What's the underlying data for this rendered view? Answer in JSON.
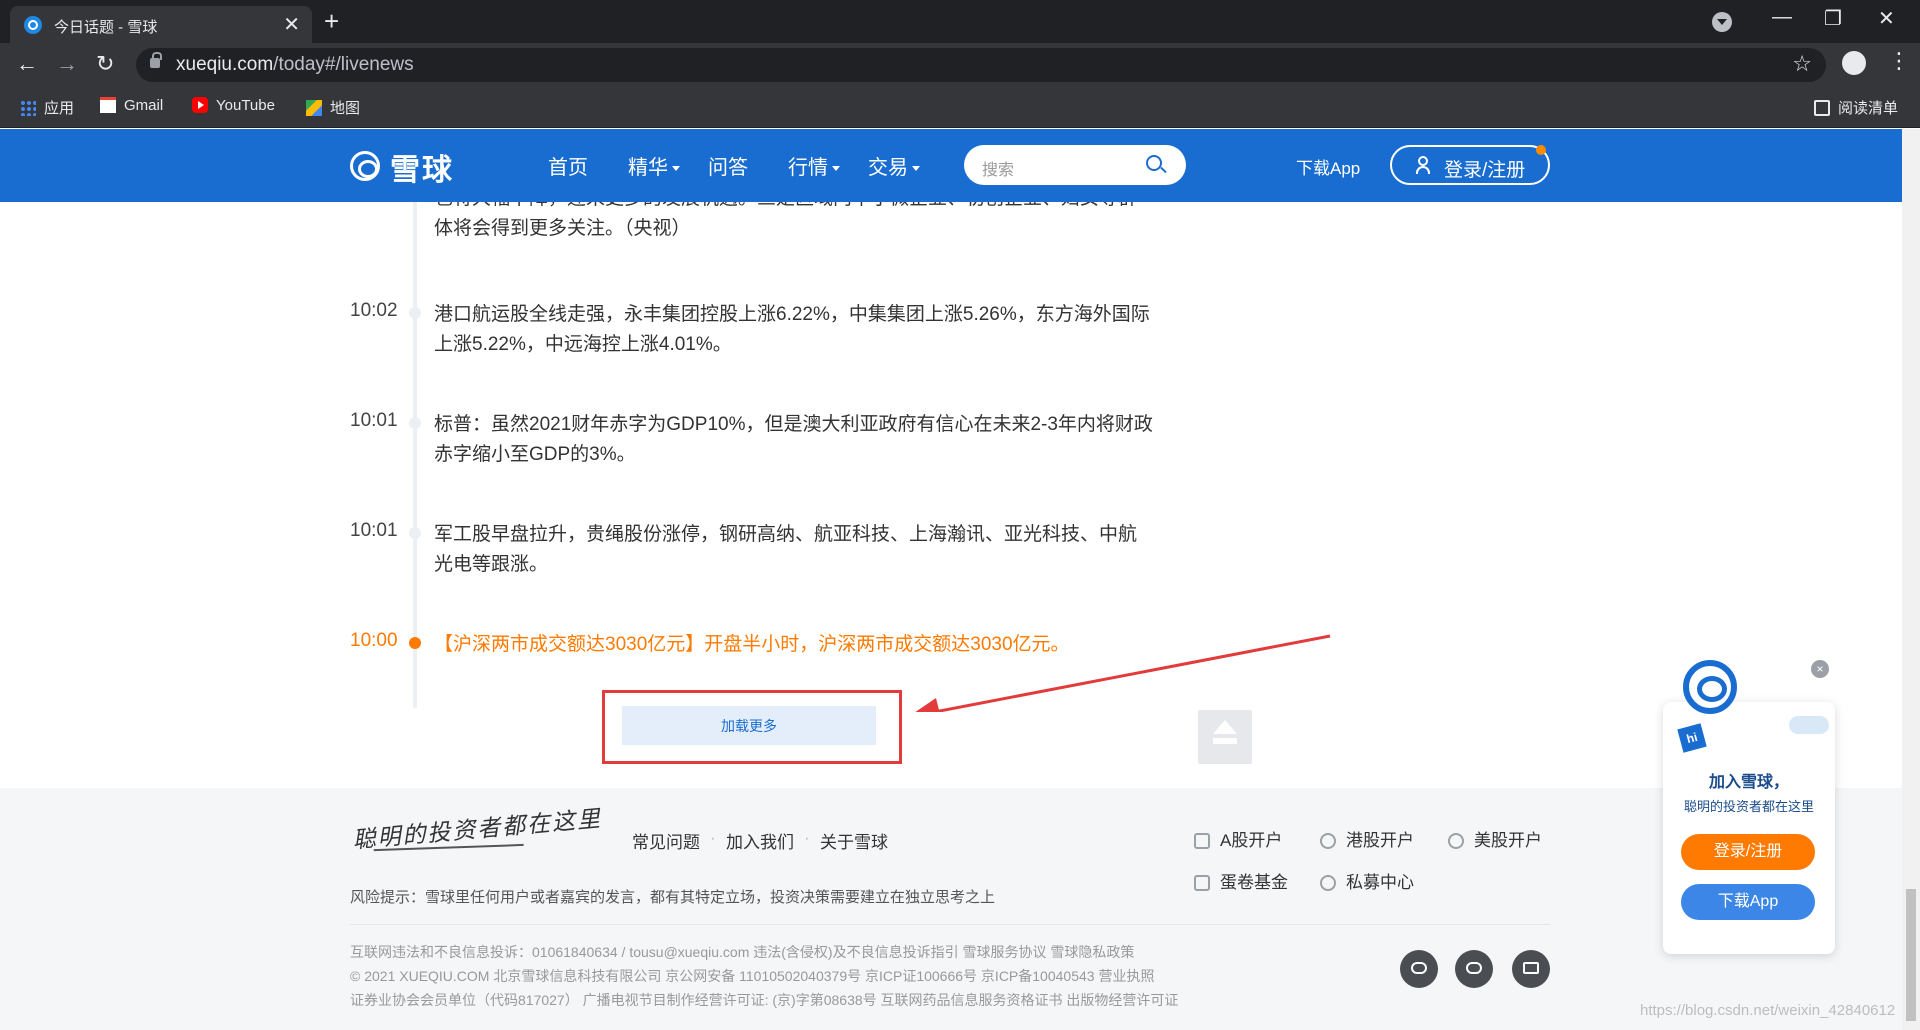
{
  "browser": {
    "tab_title": "今日话题 - 雪球",
    "tab_close": "✕",
    "new_tab": "+",
    "url_host": "xueqiu.com",
    "url_path": "/today#/livenews",
    "back": "←",
    "forward": "→",
    "reload": "↻",
    "bookmark_star": "☆",
    "menu": "⋮",
    "minimize": "—",
    "maximize": "❐",
    "close": "✕",
    "bookmarks": [
      {
        "label": "应用",
        "icon": "apps-icon"
      },
      {
        "label": "Gmail",
        "icon": "gmail-icon"
      },
      {
        "label": "YouTube",
        "icon": "youtube-icon"
      },
      {
        "label": "地图",
        "icon": "maps-icon"
      }
    ],
    "reading_list": "阅读清单"
  },
  "header": {
    "logo_text": "雪球",
    "nav": [
      "首页",
      "精华",
      "问答",
      "行情",
      "交易"
    ],
    "search_placeholder": "搜索",
    "download_app": "下载App",
    "login": "登录/注册",
    "brand_color": "#1a6dd0",
    "accent_color": "#ff7a00"
  },
  "news": [
    {
      "time": "",
      "text": "也将大幅下降，迎来更多的发展机遇。三是区域内中小微企业、初创企业、妇女等群体将会得到更多关注。（央视）"
    },
    {
      "time": "10:02",
      "text": "港口航运股全线走强，永丰集团控股上涨6.22%，中集集团上涨5.26%，东方海外国际上涨5.22%，中远海控上涨4.01%。"
    },
    {
      "time": "10:01",
      "text": "标普：虽然2021财年赤字为GDP10%，但是澳大利亚政府有信心在未来2-3年内将财政赤字缩小至GDP的3%。"
    },
    {
      "time": "10:01",
      "text": "军工股早盘拉升，贵绳股份涨停，钢研高纳、航亚科技、上海瀚讯、亚光科技、中航光电等跟涨。"
    },
    {
      "time": "10:00",
      "text": "【沪深两市成交额达3030亿元】开盘半小时，沪深两市成交额达3030亿元。"
    }
  ],
  "load_more": "加载更多",
  "footer": {
    "slogan": "聪明的投资者都在这里",
    "links": [
      "常见问题",
      "加入我们",
      "关于雪球"
    ],
    "link_sep": "·",
    "risk": "风险提示：雪球里任何用户或者嘉宾的发言，都有其特定立场，投资决策需要建立在独立思考之上",
    "accounts": [
      "A股开户",
      "港股开户",
      "美股开户",
      "蛋卷基金",
      "私募中心"
    ],
    "legal": [
      "互联网违法和不良信息投诉：01061840634 / tousu@xueqiu.com 违法(含侵权)及不良信息投诉指引   雪球服务协议   雪球隐私政策",
      "© 2021 XUEQIU.COM   北京雪球信息科技有限公司   京公网安备 11010502040379号   京ICP证100666号   京ICP备10040543   营业执照",
      "证券业协会会员单位（代码817027）   广播电视节目制作经营许可证: (京)字第08638号   互联网药品信息服务资格证书   出版物经营许可证"
    ]
  },
  "promo": {
    "badge": "hi",
    "close": "×",
    "title": "加入雪球，",
    "subtitle": "聪明的投资者都在这里",
    "login": "登录/注册",
    "download": "下载App"
  },
  "watermark": "https://blog.csdn.net/weixin_42840612"
}
